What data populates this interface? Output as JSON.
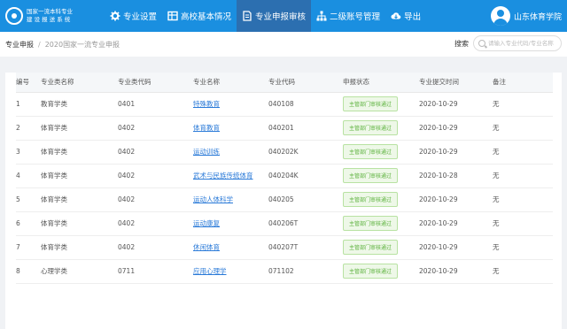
{
  "header": {
    "logo_line1": "国家一流本科专业",
    "logo_line2": "建 设 报 送 系 统",
    "nav": [
      {
        "label": "专业设置",
        "icon": "gear-icon"
      },
      {
        "label": "高校基本情况",
        "icon": "table-icon"
      },
      {
        "label": "专业申报审核",
        "icon": "document-icon"
      },
      {
        "label": "二级账号管理",
        "icon": "org-chart-icon"
      },
      {
        "label": "导出",
        "icon": "cloud-download-icon"
      }
    ],
    "user_name": "山东体育学院"
  },
  "breadcrumb": {
    "item1": "专业申报",
    "sep": "/",
    "item2": "2020国家一流专业申报"
  },
  "search": {
    "label": "搜索",
    "placeholder": "请输入专业代码/专业名称"
  },
  "table": {
    "headers": [
      "编号",
      "专业类名称",
      "专业类代码",
      "专业名称",
      "专业代码",
      "申报状态",
      "专业提交时间",
      "备注"
    ],
    "rows": [
      {
        "no": "1",
        "cat": "教育学类",
        "cat_code": "0401",
        "name": "特殊教育",
        "code": "040108",
        "status": "主管部门审核通过",
        "time": "2020-10-29",
        "note": "无"
      },
      {
        "no": "2",
        "cat": "体育学类",
        "cat_code": "0402",
        "name": "体育教育",
        "code": "040201",
        "status": "主管部门审核通过",
        "time": "2020-10-29",
        "note": "无"
      },
      {
        "no": "3",
        "cat": "体育学类",
        "cat_code": "0402",
        "name": "运动训练",
        "code": "040202K",
        "status": "主管部门审核通过",
        "time": "2020-10-29",
        "note": "无"
      },
      {
        "no": "4",
        "cat": "体育学类",
        "cat_code": "0402",
        "name": "武术与民族传统体育",
        "code": "040204K",
        "status": "主管部门审核通过",
        "time": "2020-10-28",
        "note": "无"
      },
      {
        "no": "5",
        "cat": "体育学类",
        "cat_code": "0402",
        "name": "运动人体科学",
        "code": "040205",
        "status": "主管部门审核通过",
        "time": "2020-10-29",
        "note": "无"
      },
      {
        "no": "6",
        "cat": "体育学类",
        "cat_code": "0402",
        "name": "运动康复",
        "code": "040206T",
        "status": "主管部门审核通过",
        "time": "2020-10-29",
        "note": "无"
      },
      {
        "no": "7",
        "cat": "体育学类",
        "cat_code": "0402",
        "name": "休闲体育",
        "code": "040207T",
        "status": "主管部门审核通过",
        "time": "2020-10-29",
        "note": "无"
      },
      {
        "no": "8",
        "cat": "心理学类",
        "cat_code": "0711",
        "name": "应用心理学",
        "code": "071102",
        "status": "主管部门审核通过",
        "time": "2020-10-29",
        "note": "无"
      }
    ]
  },
  "colors": {
    "topbar": "#1a8fe0",
    "nav_active": "#2c6fb0",
    "link": "#2a7ad8",
    "status_green": "#5db23e"
  }
}
